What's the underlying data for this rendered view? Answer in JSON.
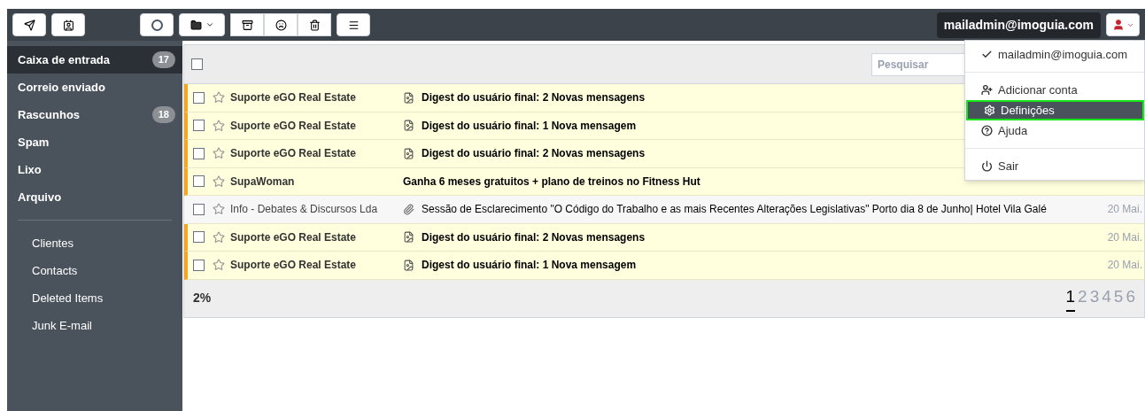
{
  "account": {
    "email": "mailadmin@imoguia.com"
  },
  "folders": [
    {
      "label": "Caixa de entrada",
      "count": "17",
      "selected": true
    },
    {
      "label": "Correio enviado",
      "selected": false
    },
    {
      "label": "Rascunhos",
      "count": "18",
      "selected": false
    },
    {
      "label": "Spam",
      "selected": false
    },
    {
      "label": "Lixo",
      "selected": false
    },
    {
      "label": "Arquivo",
      "selected": false
    }
  ],
  "subfolders": [
    "Clientes",
    "Contacts",
    "Deleted Items",
    "Junk E-mail"
  ],
  "select_all": {
    "checked": false
  },
  "search": {
    "placeholder": "Pesquisar"
  },
  "messages": [
    {
      "sender": "Suporte eGO Real Estate",
      "subject": "Digest do usuário final: 2 Novas mensagens",
      "unread": true,
      "kind": "digest",
      "checked": false,
      "starred": false
    },
    {
      "sender": "Suporte eGO Real Estate",
      "subject": "Digest do usuário final: 1 Nova mensagem",
      "unread": true,
      "kind": "digest",
      "checked": false,
      "starred": false
    },
    {
      "sender": "Suporte eGO Real Estate",
      "subject": "Digest do usuário final: 2 Novas mensagens",
      "unread": true,
      "kind": "digest",
      "checked": false,
      "starred": false
    },
    {
      "sender": "SupaWoman",
      "subject": "Ganha 6 meses gratuitos + plano de treinos no Fitness Hut",
      "unread": true,
      "kind": "plain",
      "checked": false,
      "starred": false
    },
    {
      "sender": "Info - Debates & Discursos Lda",
      "subject": "Sessão de Esclarecimento \"O Código do Trabalho e as mais Recentes Alterações Legislativas\" Porto dia 8 de Junho| Hotel Vila Galé",
      "unread": false,
      "kind": "attachment",
      "checked": false,
      "starred": false,
      "date": "20 Mai."
    },
    {
      "sender": "Suporte eGO Real Estate",
      "subject": "Digest do usuário final: 2 Novas mensagens",
      "unread": true,
      "kind": "digest",
      "checked": false,
      "starred": false,
      "date": "20 Mai."
    },
    {
      "sender": "Suporte eGO Real Estate",
      "subject": "Digest do usuário final: 1 Nova mensagem",
      "unread": true,
      "kind": "digest",
      "checked": false,
      "starred": false,
      "date": "20 Mai."
    }
  ],
  "footer": {
    "progress": "2%",
    "pages": [
      {
        "label": "1",
        "selected": true
      },
      {
        "label": "2",
        "selected": false
      },
      {
        "label": "3",
        "selected": false
      },
      {
        "label": "4",
        "selected": false
      },
      {
        "label": "5",
        "selected": false
      },
      {
        "label": "6",
        "selected": false
      }
    ]
  },
  "account_menu": {
    "items": [
      {
        "kind": "account",
        "label": "mailadmin@imoguia.com",
        "selected": false
      },
      {
        "kind": "divider"
      },
      {
        "kind": "add",
        "label": "Adicionar conta",
        "selected": false
      },
      {
        "kind": "settings",
        "label": "Definições",
        "selected": true
      },
      {
        "kind": "help",
        "label": "Ajuda",
        "selected": false
      },
      {
        "kind": "divider"
      },
      {
        "kind": "logout",
        "label": "Sair",
        "selected": false
      }
    ]
  }
}
